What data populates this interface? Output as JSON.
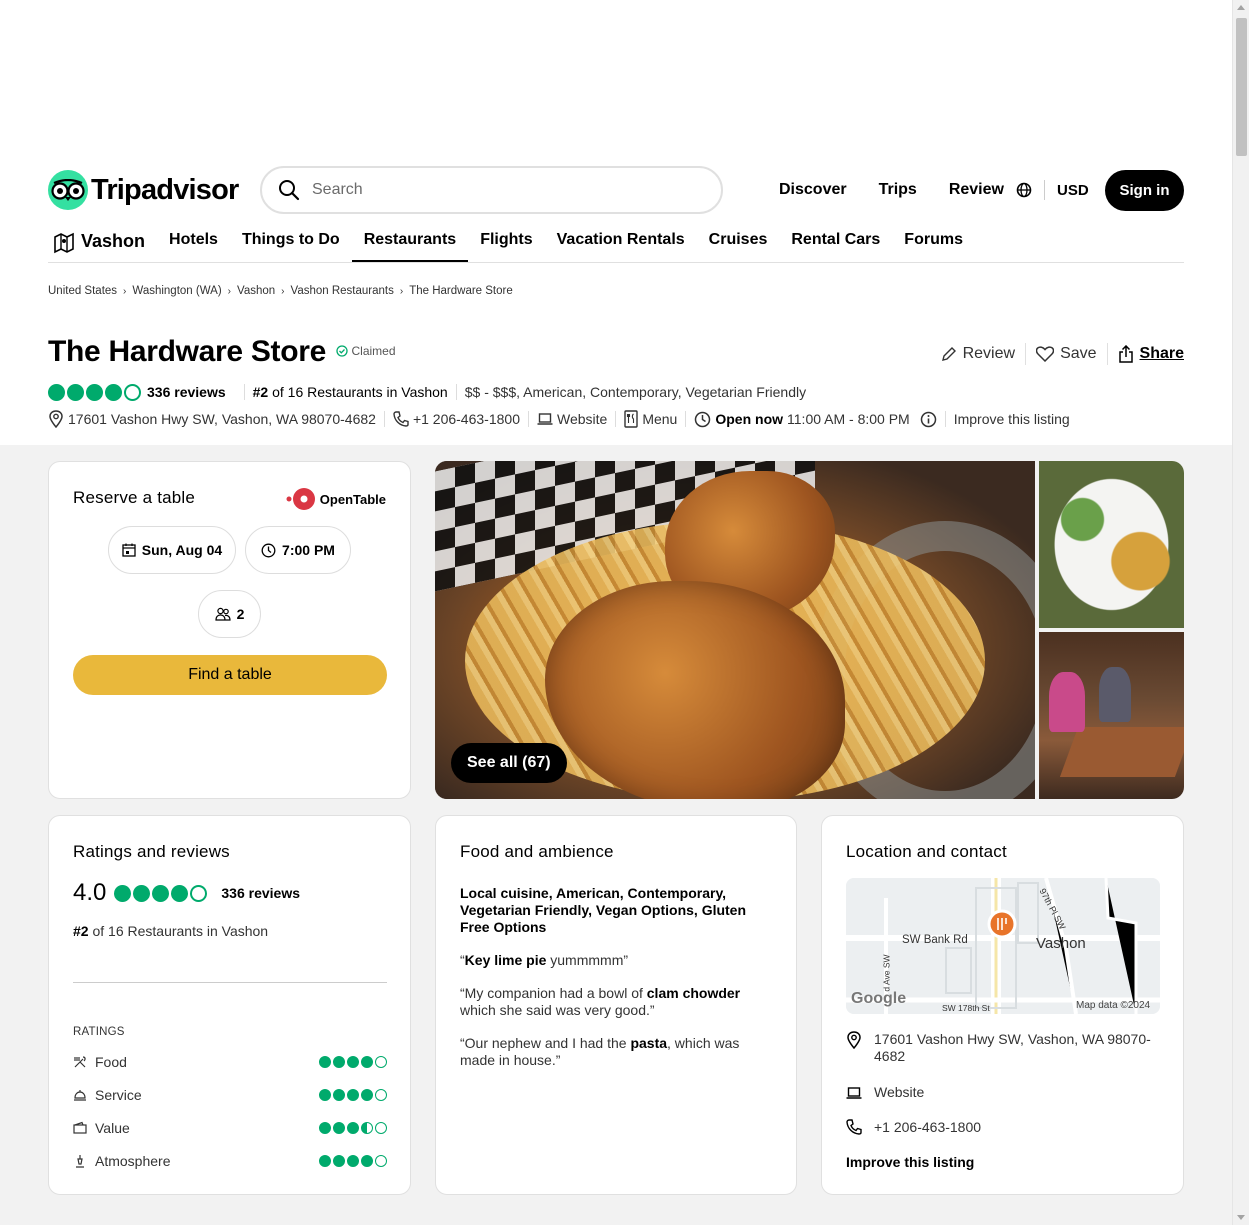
{
  "header": {
    "logo_text": "Tripadvisor",
    "search_placeholder": "Search",
    "nav": [
      "Discover",
      "Trips",
      "Review"
    ],
    "currency": "USD",
    "signin_label": "Sign in"
  },
  "subnav": {
    "home": "Vashon",
    "items": [
      "Hotels",
      "Things to Do",
      "Restaurants",
      "Flights",
      "Vacation Rentals",
      "Cruises",
      "Rental Cars",
      "Forums"
    ],
    "active": "Restaurants"
  },
  "breadcrumb": [
    "United States",
    "Washington (WA)",
    "Vashon",
    "Vashon Restaurants",
    "The Hardware Store"
  ],
  "restaurant": {
    "name": "The Hardware Store",
    "claimed": "Claimed",
    "rating": 4.0,
    "reviews": "336 reviews",
    "rank_bold": "#2",
    "rank_rest": " of 16 Restaurants in Vashon",
    "price_cuisine": "$$ - $$$, American, Contemporary, Vegetarian Friendly",
    "address": "17601 Vashon Hwy SW, Vashon, WA 98070-4682",
    "phone": "+1 206-463-1800",
    "website": "Website",
    "menu": "Menu",
    "open_now": "Open now",
    "hours": "11:00 AM - 8:00 PM",
    "improve": "Improve this listing"
  },
  "actions": {
    "review": "Review",
    "save": "Save",
    "share": "Share"
  },
  "reserve": {
    "title": "Reserve a table",
    "brand": "OpenTable",
    "date": "Sun, Aug 04",
    "time": "7:00 PM",
    "party": "2",
    "button": "Find a table"
  },
  "photos": {
    "see_all": "See all (67)"
  },
  "ratings": {
    "title": "Ratings and reviews",
    "score": "4.0",
    "reviews": "336 reviews",
    "rank_bold": "#2",
    "rank_rest": " of 16 Restaurants in Vashon",
    "label": "RATINGS",
    "items": [
      {
        "name": "Food",
        "value": 4.0
      },
      {
        "name": "Service",
        "value": 4.0
      },
      {
        "name": "Value",
        "value": 3.5
      },
      {
        "name": "Atmosphere",
        "value": 4.0
      }
    ]
  },
  "food": {
    "title": "Food and ambience",
    "cuisines": "Local cuisine, American, Contemporary, Vegetarian Friendly, Vegan Options, Gluten Free Options",
    "q1_open": "“",
    "q1_bold": "Key lime pie",
    "q1_rest": " yummmmm”",
    "q2_a": "“My companion had a bowl of ",
    "q2_bold": "clam chowder",
    "q2_b": " which she said was very good.”",
    "q3_a": "“Our nephew and I had the ",
    "q3_bold": "pasta",
    "q3_b": ", which was made in house.”"
  },
  "location": {
    "title": "Location and contact",
    "map_labels": {
      "road1": "SW Bank Rd",
      "town": "Vashon",
      "road2": "97th Pl SW",
      "road3": "SW 178th St",
      "road4": "d Ave SW",
      "google": "Google",
      "mapdata": "Map data ©2024"
    },
    "address": "17601 Vashon Hwy SW, Vashon, WA 98070-4682",
    "website": "Website",
    "phone": "+1 206-463-1800",
    "improve": "Improve this listing"
  },
  "colors": {
    "bubble_green": "#00aa6c",
    "find_table_yellow": "#e9b83b",
    "logo_green": "#34e0a1",
    "opentable_red": "#da3743"
  }
}
